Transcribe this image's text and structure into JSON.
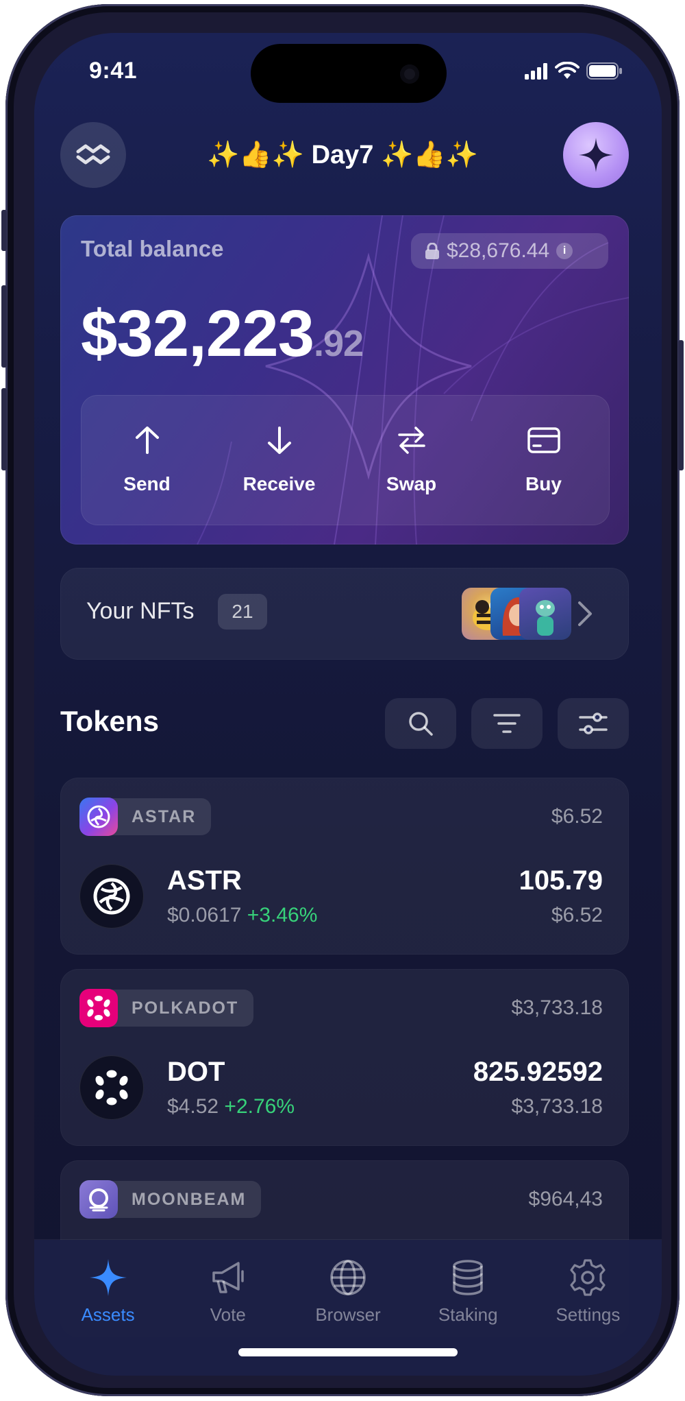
{
  "status_bar": {
    "time": "9:41"
  },
  "header": {
    "title": "✨👍✨ Day7 ✨👍✨"
  },
  "balance": {
    "label": "Total balance",
    "locked_amount": "$28,676.44",
    "info": "i",
    "amount_main": "$32,223",
    "amount_cents": ".92"
  },
  "actions": [
    {
      "label": "Send",
      "icon": "arrow-up-icon"
    },
    {
      "label": "Receive",
      "icon": "arrow-down-icon"
    },
    {
      "label": "Swap",
      "icon": "swap-icon"
    },
    {
      "label": "Buy",
      "icon": "card-icon"
    }
  ],
  "nfts": {
    "label": "Your NFTs",
    "count": "21"
  },
  "tokens": {
    "title": "Tokens",
    "items": [
      {
        "chain": "ASTAR",
        "chain_value": "$6.52",
        "symbol": "ASTR",
        "price": "$0.0617",
        "change": "+3.46%",
        "amount": "105.79",
        "fiat": "$6.52"
      },
      {
        "chain": "POLKADOT",
        "chain_value": "$3,733.18",
        "symbol": "DOT",
        "price": "$4.52",
        "change": "+2.76%",
        "amount": "825.92592",
        "fiat": "$3,733.18"
      },
      {
        "chain": "MOONBEAM",
        "chain_value": "$964,43"
      }
    ]
  },
  "nav": [
    {
      "label": "Assets",
      "icon": "sparkle-icon",
      "active": true
    },
    {
      "label": "Vote",
      "icon": "megaphone-icon"
    },
    {
      "label": "Browser",
      "icon": "globe-icon"
    },
    {
      "label": "Staking",
      "icon": "database-icon"
    },
    {
      "label": "Settings",
      "icon": "gear-icon"
    }
  ],
  "colors": {
    "accent": "#3a8bff",
    "positive": "#37d27a",
    "polkadot": "#e6007a",
    "astar": "#4a6cf0"
  }
}
